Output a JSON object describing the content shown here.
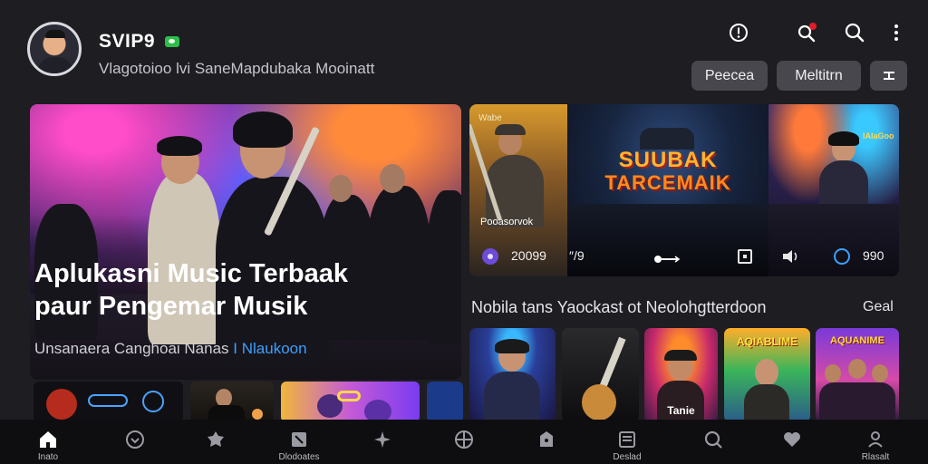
{
  "header": {
    "username": "SVIP9",
    "subtitle": "Vlagotoioo lvi SaneMapdubaka Mooinatt",
    "icons": [
      "alert-icon",
      "search-notify-icon",
      "search-icon",
      "more-vert-icon"
    ],
    "pills": [
      "Peecea",
      "Meltitrn",
      "⌷"
    ]
  },
  "hero": {
    "title_line1": "Aplukasni Music Terbaak",
    "title_line2": "paur Pengemar Musik",
    "subtitle_text": "Unsanaera Canghoai Nanas",
    "subtitle_link": "I Nlaukoon"
  },
  "banner": {
    "left_tag": "Wabe",
    "left_caption": "Pooasorvok",
    "center_title_1": "SUUBAK",
    "center_title_2": "TARCEMAIK",
    "right_tag": "lAlaGoo",
    "count_left": "20099",
    "count_mid": "″/9",
    "count_right": "990"
  },
  "section": {
    "title": "Nobila tans Yaockast ot Neolohgtterdoon",
    "see_all": "Geal"
  },
  "cards": [
    {
      "label": ""
    },
    {
      "label": ""
    },
    {
      "label": "Tanie"
    },
    {
      "label": "AQIABLIME"
    },
    {
      "label": "AQUANIME"
    }
  ],
  "nav": {
    "items": [
      {
        "label": "Inato",
        "icon": "home-icon"
      },
      {
        "label": "",
        "icon": "chevron-circle-icon"
      },
      {
        "label": "",
        "icon": "puzzle-icon"
      },
      {
        "label": "Dlodoates",
        "icon": "music-box-icon"
      },
      {
        "label": "",
        "icon": "star-icon"
      },
      {
        "label": "",
        "icon": "grid-circle-icon"
      },
      {
        "label": "",
        "icon": "bag-icon"
      },
      {
        "label": "Deslad",
        "icon": "list-icon"
      },
      {
        "label": "",
        "icon": "search-icon"
      },
      {
        "label": "",
        "icon": "heart-icon"
      },
      {
        "label": "Rlasalt",
        "icon": "profile-icon"
      }
    ]
  },
  "colors": {
    "background": "#1e1d22",
    "accent_link": "#3aa0ff",
    "status_green": "#2bbf4a",
    "notify_red": "#e11d2a"
  }
}
